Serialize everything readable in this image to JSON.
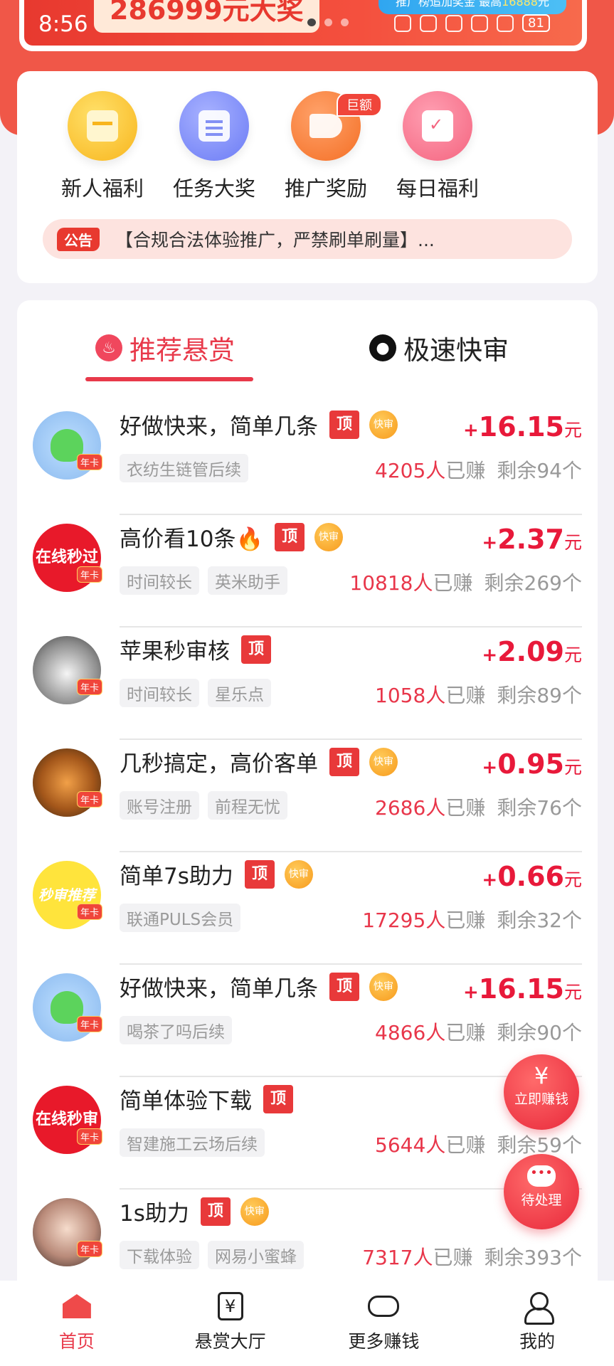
{
  "banner": {
    "prize_text": "286999元大奖",
    "time": "8:56",
    "tag_prefix": "推广榜追加奖金 最高",
    "tag_amount": "16888",
    "tag_suffix": "元",
    "battery": "81"
  },
  "shortcuts": [
    {
      "label": "新人福利",
      "icon": "gift-box-icon"
    },
    {
      "label": "任务大奖",
      "icon": "clipboard-icon"
    },
    {
      "label": "推广奖励",
      "icon": "megaphone-icon",
      "badge": "巨额"
    },
    {
      "label": "每日福利",
      "icon": "calendar-check-icon"
    }
  ],
  "notice": {
    "tag": "公告",
    "text": "【合规合法体验推广，严禁刷单刷量】..."
  },
  "tabs": [
    {
      "label": "推荐悬赏",
      "icon": "flame-icon",
      "active": true
    },
    {
      "label": "极速快审",
      "icon": "user-circle-icon",
      "active": false
    }
  ],
  "common": {
    "top_tag": "顶",
    "fast_tag": "快审",
    "year_badge": "年卡",
    "earned_suffix": "已赚",
    "remain_prefix": "剩余",
    "remain_suffix": "个",
    "currency": "元",
    "plus": "+"
  },
  "tasks": [
    {
      "title": "好做快来，简单几条",
      "top": true,
      "fast": true,
      "chips": [
        "衣纺生链管后续"
      ],
      "reward": "16.15",
      "earned": "4205人",
      "remain": "94"
    },
    {
      "title": "高价看10条🔥",
      "top": true,
      "fast": true,
      "chips": [
        "时间较长",
        "英米助手"
      ],
      "reward": "2.37",
      "earned": "10818人",
      "remain": "269",
      "avatar_text": "在线秒过"
    },
    {
      "title": "苹果秒审核",
      "top": true,
      "fast": false,
      "chips": [
        "时间较长",
        "星乐点"
      ],
      "reward": "2.09",
      "earned": "1058人",
      "remain": "89"
    },
    {
      "title": "几秒搞定，高价客单",
      "top": true,
      "fast": true,
      "chips": [
        "账号注册",
        "前程无忧"
      ],
      "reward": "0.95",
      "earned": "2686人",
      "remain": "76"
    },
    {
      "title": "简单7s助力",
      "top": true,
      "fast": true,
      "chips": [
        "联通PULS会员"
      ],
      "reward": "0.66",
      "earned": "17295人",
      "remain": "32",
      "avatar_text": "秒审推荐"
    },
    {
      "title": "好做快来，简单几条",
      "top": true,
      "fast": true,
      "chips": [
        "喝茶了吗后续"
      ],
      "reward": "16.15",
      "earned": "4866人",
      "remain": "90"
    },
    {
      "title": "简单体验下载",
      "top": true,
      "fast": false,
      "chips": [
        "智建施工云场后续"
      ],
      "reward": "",
      "earned": "5644人",
      "remain": "59",
      "avatar_text": "在线秒审"
    },
    {
      "title": "1s助力",
      "top": true,
      "fast": true,
      "chips": [
        "下载体验",
        "网易小蜜蜂"
      ],
      "reward": "",
      "earned": "7317人",
      "remain": "393"
    }
  ],
  "fabs": {
    "earn_label": "立即赚钱",
    "earn_icon": "¥",
    "pending_label": "待处理"
  },
  "nav": [
    {
      "label": "首页",
      "icon": "home-icon",
      "active": true
    },
    {
      "label": "悬赏大厅",
      "icon": "yuan-box-icon",
      "active": false
    },
    {
      "label": "更多赚钱",
      "icon": "gamepad-icon",
      "active": false
    },
    {
      "label": "我的",
      "icon": "user-icon",
      "active": false
    }
  ],
  "colors": {
    "brand_red": "#e8394a",
    "banner_red": "#f05748",
    "reward_red": "#e8193a"
  }
}
